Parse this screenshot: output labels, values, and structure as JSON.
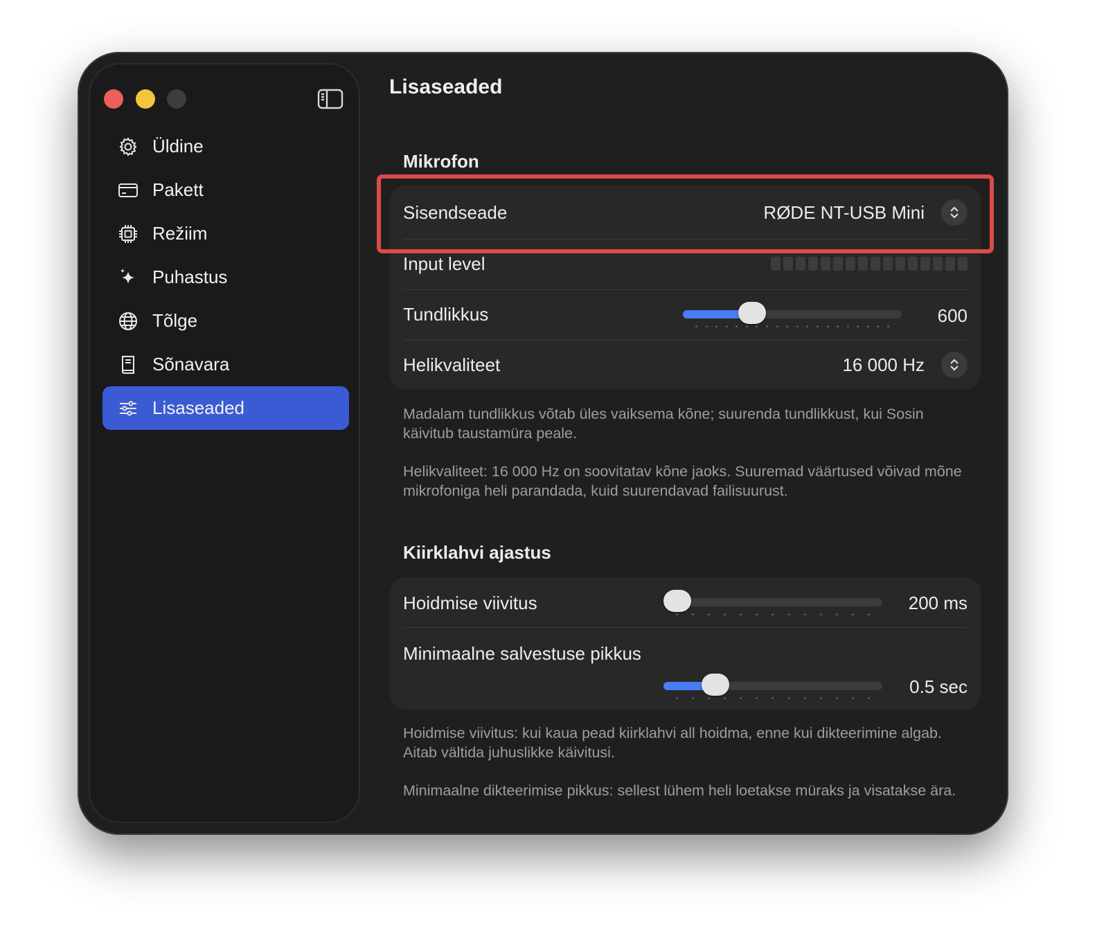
{
  "sidebar": {
    "items": [
      {
        "label": "Üldine",
        "icon": "gear-icon"
      },
      {
        "label": "Pakett",
        "icon": "credit-card-icon"
      },
      {
        "label": "Režiim",
        "icon": "cpu-chip-icon"
      },
      {
        "label": "Puhastus",
        "icon": "sparkles-icon"
      },
      {
        "label": "Tõlge",
        "icon": "globe-icon"
      },
      {
        "label": "Sõnavara",
        "icon": "book-icon"
      },
      {
        "label": "Lisaseaded",
        "icon": "sliders-icon",
        "active": true
      }
    ]
  },
  "main": {
    "title": "Lisaseaded",
    "microphone": {
      "section_title": "Mikrofon",
      "input_device_label": "Sisendseade",
      "input_device_value": "RØDE NT-USB Mini",
      "input_level_label": "Input level",
      "input_level_segments": 16,
      "input_level_active": 0,
      "sensitivity_label": "Tundlikkus",
      "sensitivity_value": "600",
      "sensitivity_fraction": 0.29,
      "audio_quality_label": "Helikvaliteet",
      "audio_quality_value": "16 000 Hz",
      "note_1": "Madalam tundlikkus võtab üles vaiksema kõne; suurenda tundlikkust, kui Sosin käivitub taustamüra peale.",
      "note_2": "Helikvaliteet: 16 000 Hz on soovitatav kõne jaoks. Suuremad väärtused võivad mõne mikrofoniga heli parandada, kuid suurendavad failisuurust."
    },
    "hotkey": {
      "section_title": "Kiirklahvi ajastus",
      "hold_delay_label": "Hoidmise viivitus",
      "hold_delay_value": "200 ms",
      "hold_delay_fraction": 0.0,
      "min_length_label": "Minimaalne salvestuse pikkus",
      "min_length_value": "0.5 sec",
      "min_length_fraction": 0.2,
      "note_1": "Hoidmise viivitus: kui kaua pead kiirklahvi all hoidma, enne kui dikteerimine algab. Aitab vältida juhuslikke käivitusi.",
      "note_2": "Minimaalne dikteerimise pikkus: sellest lühem heli loetakse müraks ja visatakse ära."
    }
  },
  "colors": {
    "accent": "#3a5bd3",
    "slider_fill": "#4a7cf5",
    "highlight": "#dc4a4a",
    "close": "#ec5f5a",
    "minimize": "#f2c53d"
  }
}
